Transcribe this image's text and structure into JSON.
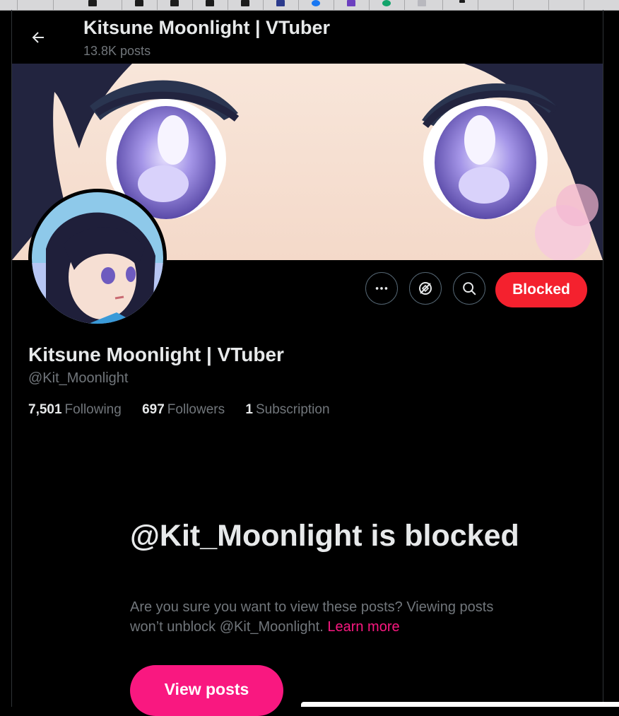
{
  "header": {
    "title": "Kitsune Moonlight | VTuber",
    "posts_count": "13.8K posts"
  },
  "profile": {
    "display_name": "Kitsune Moonlight | VTuber",
    "handle": "@Kit_Moonlight",
    "stats": [
      {
        "value": "7,501",
        "label": "Following"
      },
      {
        "value": "697",
        "label": "Followers"
      },
      {
        "value": "1",
        "label": "Subscription"
      }
    ]
  },
  "actions": {
    "more_icon": "more-icon",
    "subscribe_icon": "subscription-icon",
    "search_icon": "search-icon",
    "blocked_label": "Blocked"
  },
  "blocked_notice": {
    "title": "@Kit_Moonlight is blocked",
    "description": "Are you sure you want to view these posts? Viewing posts won’t unblock @Kit_Moonlight.",
    "learn_more": "Learn more",
    "button_label": "View posts"
  },
  "colors": {
    "accent_pink": "#f91880",
    "blocked_red": "#f4212e",
    "muted_text": "#71767b",
    "background": "#000000"
  }
}
